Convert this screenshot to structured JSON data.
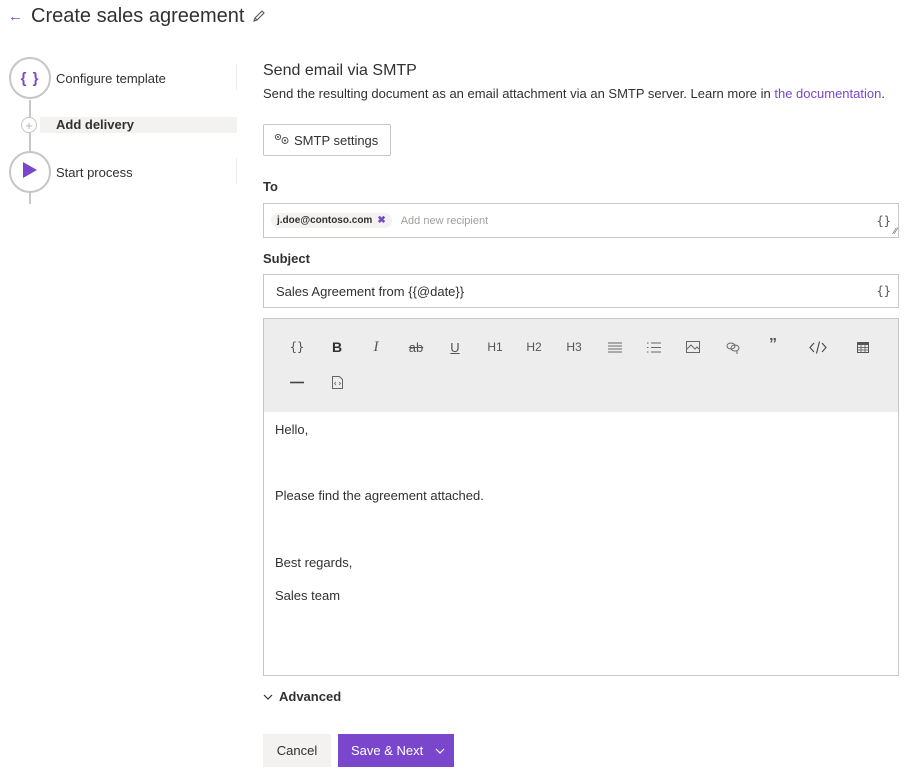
{
  "header": {
    "title": "Create sales agreement",
    "back_icon": "arrow-left-icon",
    "edit_icon": "pencil-icon"
  },
  "stepper": {
    "steps": [
      {
        "label": "Configure template",
        "icon": "braces-icon",
        "state": "completed"
      },
      {
        "label": "Add delivery",
        "icon": "plus-icon",
        "state": "active"
      },
      {
        "label": "Start process",
        "icon": "play-icon",
        "state": "pending"
      }
    ]
  },
  "main": {
    "title": "Send email via SMTP",
    "description": "Send the resulting document as an email attachment via an SMTP server. Learn more in ",
    "doc_link": "the documentation",
    "doc_link_suffix": ".",
    "smtp_settings_label": "SMTP settings",
    "to": {
      "label": "To",
      "recipients": [
        "j.doe@contoso.com"
      ],
      "placeholder": "Add new recipient"
    },
    "subject": {
      "label": "Subject",
      "value": "Sales Agreement from {{@date}}"
    },
    "toolbar": {
      "row1": [
        "variable",
        "bold",
        "italic",
        "strikethrough",
        "underline",
        "H1",
        "H2",
        "H3",
        "bullet-list",
        "numbered-list",
        "image",
        "link",
        "quote",
        "code",
        "table"
      ],
      "row2": [
        "horizontal-rule",
        "html-source"
      ],
      "labels": {
        "h1": "H1",
        "h2": "H2",
        "h3": "H3",
        "bold": "B",
        "italic": "I",
        "strike": "ab",
        "underline": "U",
        "quote": "”",
        "braces": "{}"
      }
    },
    "body": {
      "lines": [
        "Hello,",
        "Please find the agreement attached.",
        "Best regards,",
        "Sales team"
      ]
    },
    "advanced_label": "Advanced",
    "cancel_label": "Cancel",
    "save_label": "Save & Next"
  },
  "colors": {
    "accent": "#7a47cc",
    "toolbar_bg": "#ededed",
    "border": "#c8c6c4"
  }
}
